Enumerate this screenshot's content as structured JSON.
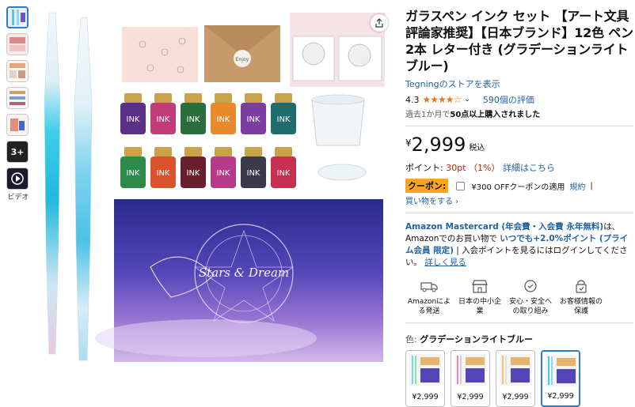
{
  "product": {
    "title": "ガラスペン インク セット 【アート文具評論家推奨】【日本ブランド】12色 ペン 2本 レター付き (グラデーションライトブルー)",
    "store_link": "Tegningのストアを表示",
    "rating_value": "4.3",
    "rating_count": "590個の評価",
    "bought_prefix": "過去1か月で",
    "bought_strong": "50点以上購入されました",
    "price_symbol": "¥",
    "price": "2,999",
    "tax_label": "税込",
    "points_label": "ポイント:",
    "points_value": "30pt （1%）",
    "points_link": "詳細はこちら",
    "coupon_badge": "クーポン:",
    "coupon_text": "¥300 OFFクーポンの適用",
    "coupon_terms": "規約",
    "coupon_sep": "|",
    "coupon_more": "買い物をする",
    "card_lead": "Amazon Mastercard (年会費・入会費 永年無料)",
    "card_mid": "は、Amazonでのお買い物で ",
    "card_emph": "いつでも+2.0%ポイント (プライム会員 限定)",
    "card_tail": " | 入会ポイントを見るにはログインしてください。",
    "card_link": "詳しく見る",
    "color_prefix": "色:",
    "color_name": "グラデーションライトブルー"
  },
  "features": [
    {
      "icon": "truck-icon",
      "label": "Amazonによる発送"
    },
    {
      "icon": "shop-icon",
      "label": "日本の中小企業"
    },
    {
      "icon": "badge-icon",
      "label": "安心・安全への取り組み"
    },
    {
      "icon": "lock-icon",
      "label": "お客様情報の保護"
    }
  ],
  "variants": [
    {
      "price": "¥2,999"
    },
    {
      "price": "¥2,999"
    },
    {
      "price": "¥2,999"
    },
    {
      "price": "¥2,999"
    }
  ],
  "gallery": {
    "more_count": "3+",
    "video_label": "ビデオ",
    "ink_label": "INK",
    "envelope_label": "Enjoy",
    "box_title": "Stars & Dream"
  },
  "colors": {
    "link": "#2162a1",
    "price_red": "#b12704",
    "star": "#de7921",
    "coupon_green": "#7fda69",
    "selected_border": "#2e7ccf"
  }
}
